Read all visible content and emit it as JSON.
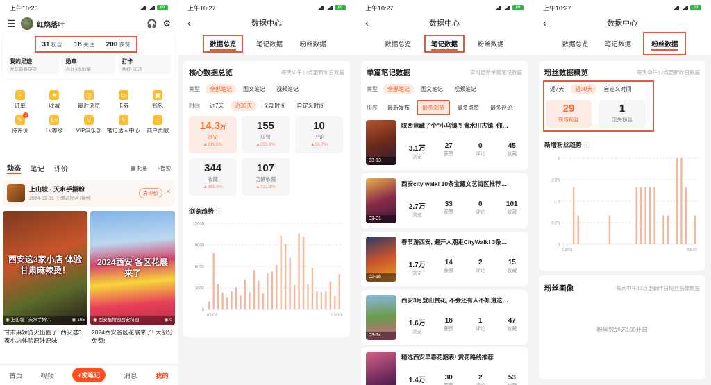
{
  "status_bar": {
    "p1_time": "上午10:26",
    "p2_time": "上午10:27",
    "p3_time": "上午10:27",
    "p4_time": "上午10:27",
    "battery": "89"
  },
  "profile": {
    "name": "红烧落叶",
    "fans_count": "31",
    "fans_label": "粉丝",
    "follow_count": "18",
    "follow_label": "关注",
    "likes_count": "200",
    "likes_label": "获赞",
    "quick_cards": [
      {
        "title": "我的足迹",
        "sub": "龙年新春足迹"
      },
      {
        "title": "勋章",
        "sub": "共计4枚勋章"
      },
      {
        "title": "打卡",
        "sub": "共打卡0次"
      }
    ],
    "grid_items": [
      "订单",
      "收藏",
      "最近浏览",
      "卡券",
      "钱包",
      "待评价",
      "Lv等级",
      "VIP俱乐部",
      "笔记达人中心",
      "商户贡献"
    ],
    "grid_badge": "1",
    "content_tabs": [
      "动态",
      "笔记",
      "评价"
    ],
    "album_label": "相册",
    "search_label": "搜索",
    "poi_title": "上山坡 · 天水手擀粉",
    "poi_sub": "2024-03-31 上传过图片/视频",
    "poi_button": "去评价",
    "feed": [
      {
        "cover_text": "西安这3家小店 体验甘肃麻辣烫！",
        "loc": "上山坡 · 天水手擀…",
        "likes": "166",
        "caption": "甘肃麻辣烫火出圈了! 西安这3家小店体验原汁原味!"
      },
      {
        "cover_text": "2024西安 各区花展来了",
        "loc": "西安植物园西安科园",
        "likes": "0",
        "caption": "2024西安各区花展来了! 大部分免费!"
      }
    ],
    "bottom_nav": [
      "首页",
      "视频",
      "+发笔记",
      "消息",
      "我的"
    ]
  },
  "header_title": "数据中心",
  "top_tabs": [
    "数据总览",
    "笔记数据",
    "粉丝数据"
  ],
  "overview": {
    "title": "核心数据总览",
    "note": "每天中午12点更新昨日数据",
    "type_label": "类型",
    "type_chips": [
      "全部笔记",
      "图文笔记",
      "视频笔记"
    ],
    "time_label": "时间",
    "time_chips": [
      "近7天",
      "近30天",
      "全部时间",
      "自定义时间"
    ],
    "metrics": [
      {
        "value": "14.3",
        "unit": "万",
        "label": "浏览",
        "change": "▲311.8%"
      },
      {
        "value": "155",
        "unit": "",
        "label": "获赞",
        "change": "▲355.9%"
      },
      {
        "value": "10",
        "unit": "",
        "label": "评论",
        "change": "▲66.7%"
      },
      {
        "value": "344",
        "unit": "",
        "label": "收藏",
        "change": "▲681.8%"
      },
      {
        "value": "107",
        "unit": "",
        "label": "店铺收藏",
        "change": "▲723.1%"
      }
    ],
    "trend_title": "浏览趋势"
  },
  "notes_page": {
    "title": "单篇笔记数据",
    "note": "实时更新单篇笔记数据",
    "type_label": "类型",
    "type_chips": [
      "全部笔记",
      "图文笔记",
      "视频笔记"
    ],
    "sort_label": "排序",
    "sort_chips": [
      "最新发布",
      "最多浏览",
      "最多点赞",
      "最多评论"
    ],
    "stat_labels": [
      "浏览",
      "获赞",
      "评论",
      "收藏"
    ],
    "notes": [
      {
        "title": "陕西竟藏了个\"小乌镇\"! 青木川古镇, 你…",
        "date": "03-13",
        "views": "3.1万",
        "likes": "27",
        "comments": "0",
        "collects": "45"
      },
      {
        "title": "西安city walk! 10条宝藏文艺街区推荐…",
        "date": "03-01",
        "views": "2.7万",
        "likes": "33",
        "comments": "0",
        "collects": "101"
      },
      {
        "title": "春节游西安, 避开人潮走CityWalk! 3条…",
        "date": "02-16",
        "views": "1.7万",
        "likes": "14",
        "comments": "2",
        "collects": "15"
      },
      {
        "title": "西安3月登山赏花, 不会还有人不知道这…",
        "date": "03-14",
        "views": "1.6万",
        "likes": "18",
        "comments": "1",
        "collects": "47"
      },
      {
        "title": "精选西安早春花期表! 赏花路线推荐",
        "date": "",
        "views": "1.4万",
        "likes": "30",
        "comments": "2",
        "collects": "53"
      }
    ]
  },
  "fans_page": {
    "title": "粉丝数据概览",
    "note": "每天中午12点更新昨日数据",
    "time_chips": [
      "近7天",
      "近30天",
      "自定义时间"
    ],
    "new_fans_value": "29",
    "new_fans_label": "新增粉丝",
    "lost_fans_value": "1",
    "lost_fans_label": "流失粉丝",
    "trend_title": "新增粉丝趋势",
    "portrait_title": "粉丝画像",
    "portrait_note": "每天中午12点更新昨日粉丝画像数据",
    "portrait_empty": "粉丝数到达100开启"
  },
  "chart_data": [
    {
      "type": "bar",
      "title": "浏览趋势",
      "x_start_label": "03/01",
      "x_end_label": "03/30",
      "yticks": [
        "12000",
        "9000",
        "6000",
        "3000",
        "0"
      ],
      "ylim": [
        0,
        12000
      ],
      "grid": true,
      "color": "#f4b89c",
      "values": [
        1100,
        7900,
        3500,
        2300,
        1700,
        2500,
        3100,
        2000,
        4200,
        2400,
        5500,
        4000,
        2200,
        5000,
        5300,
        6200,
        10300,
        9100,
        7200,
        3400,
        10600,
        10100,
        3500,
        5800,
        2500,
        2400,
        2500,
        3900,
        1900,
        4900
      ]
    },
    {
      "type": "bar",
      "title": "新增粉丝趋势",
      "x_start_label": "03/01",
      "x_end_label": "03/30",
      "yticks": [
        "3",
        "2.25",
        "1.5",
        "0.75",
        "0"
      ],
      "ylim": [
        0,
        3
      ],
      "grid": true,
      "color": "#f4b89c",
      "values": [
        0,
        0,
        2,
        1,
        0,
        0,
        0,
        0,
        0,
        0,
        1,
        0,
        0,
        0,
        0,
        0,
        2,
        2,
        2,
        2,
        2,
        0,
        1,
        1,
        0,
        3,
        3,
        2,
        0,
        1
      ]
    }
  ]
}
